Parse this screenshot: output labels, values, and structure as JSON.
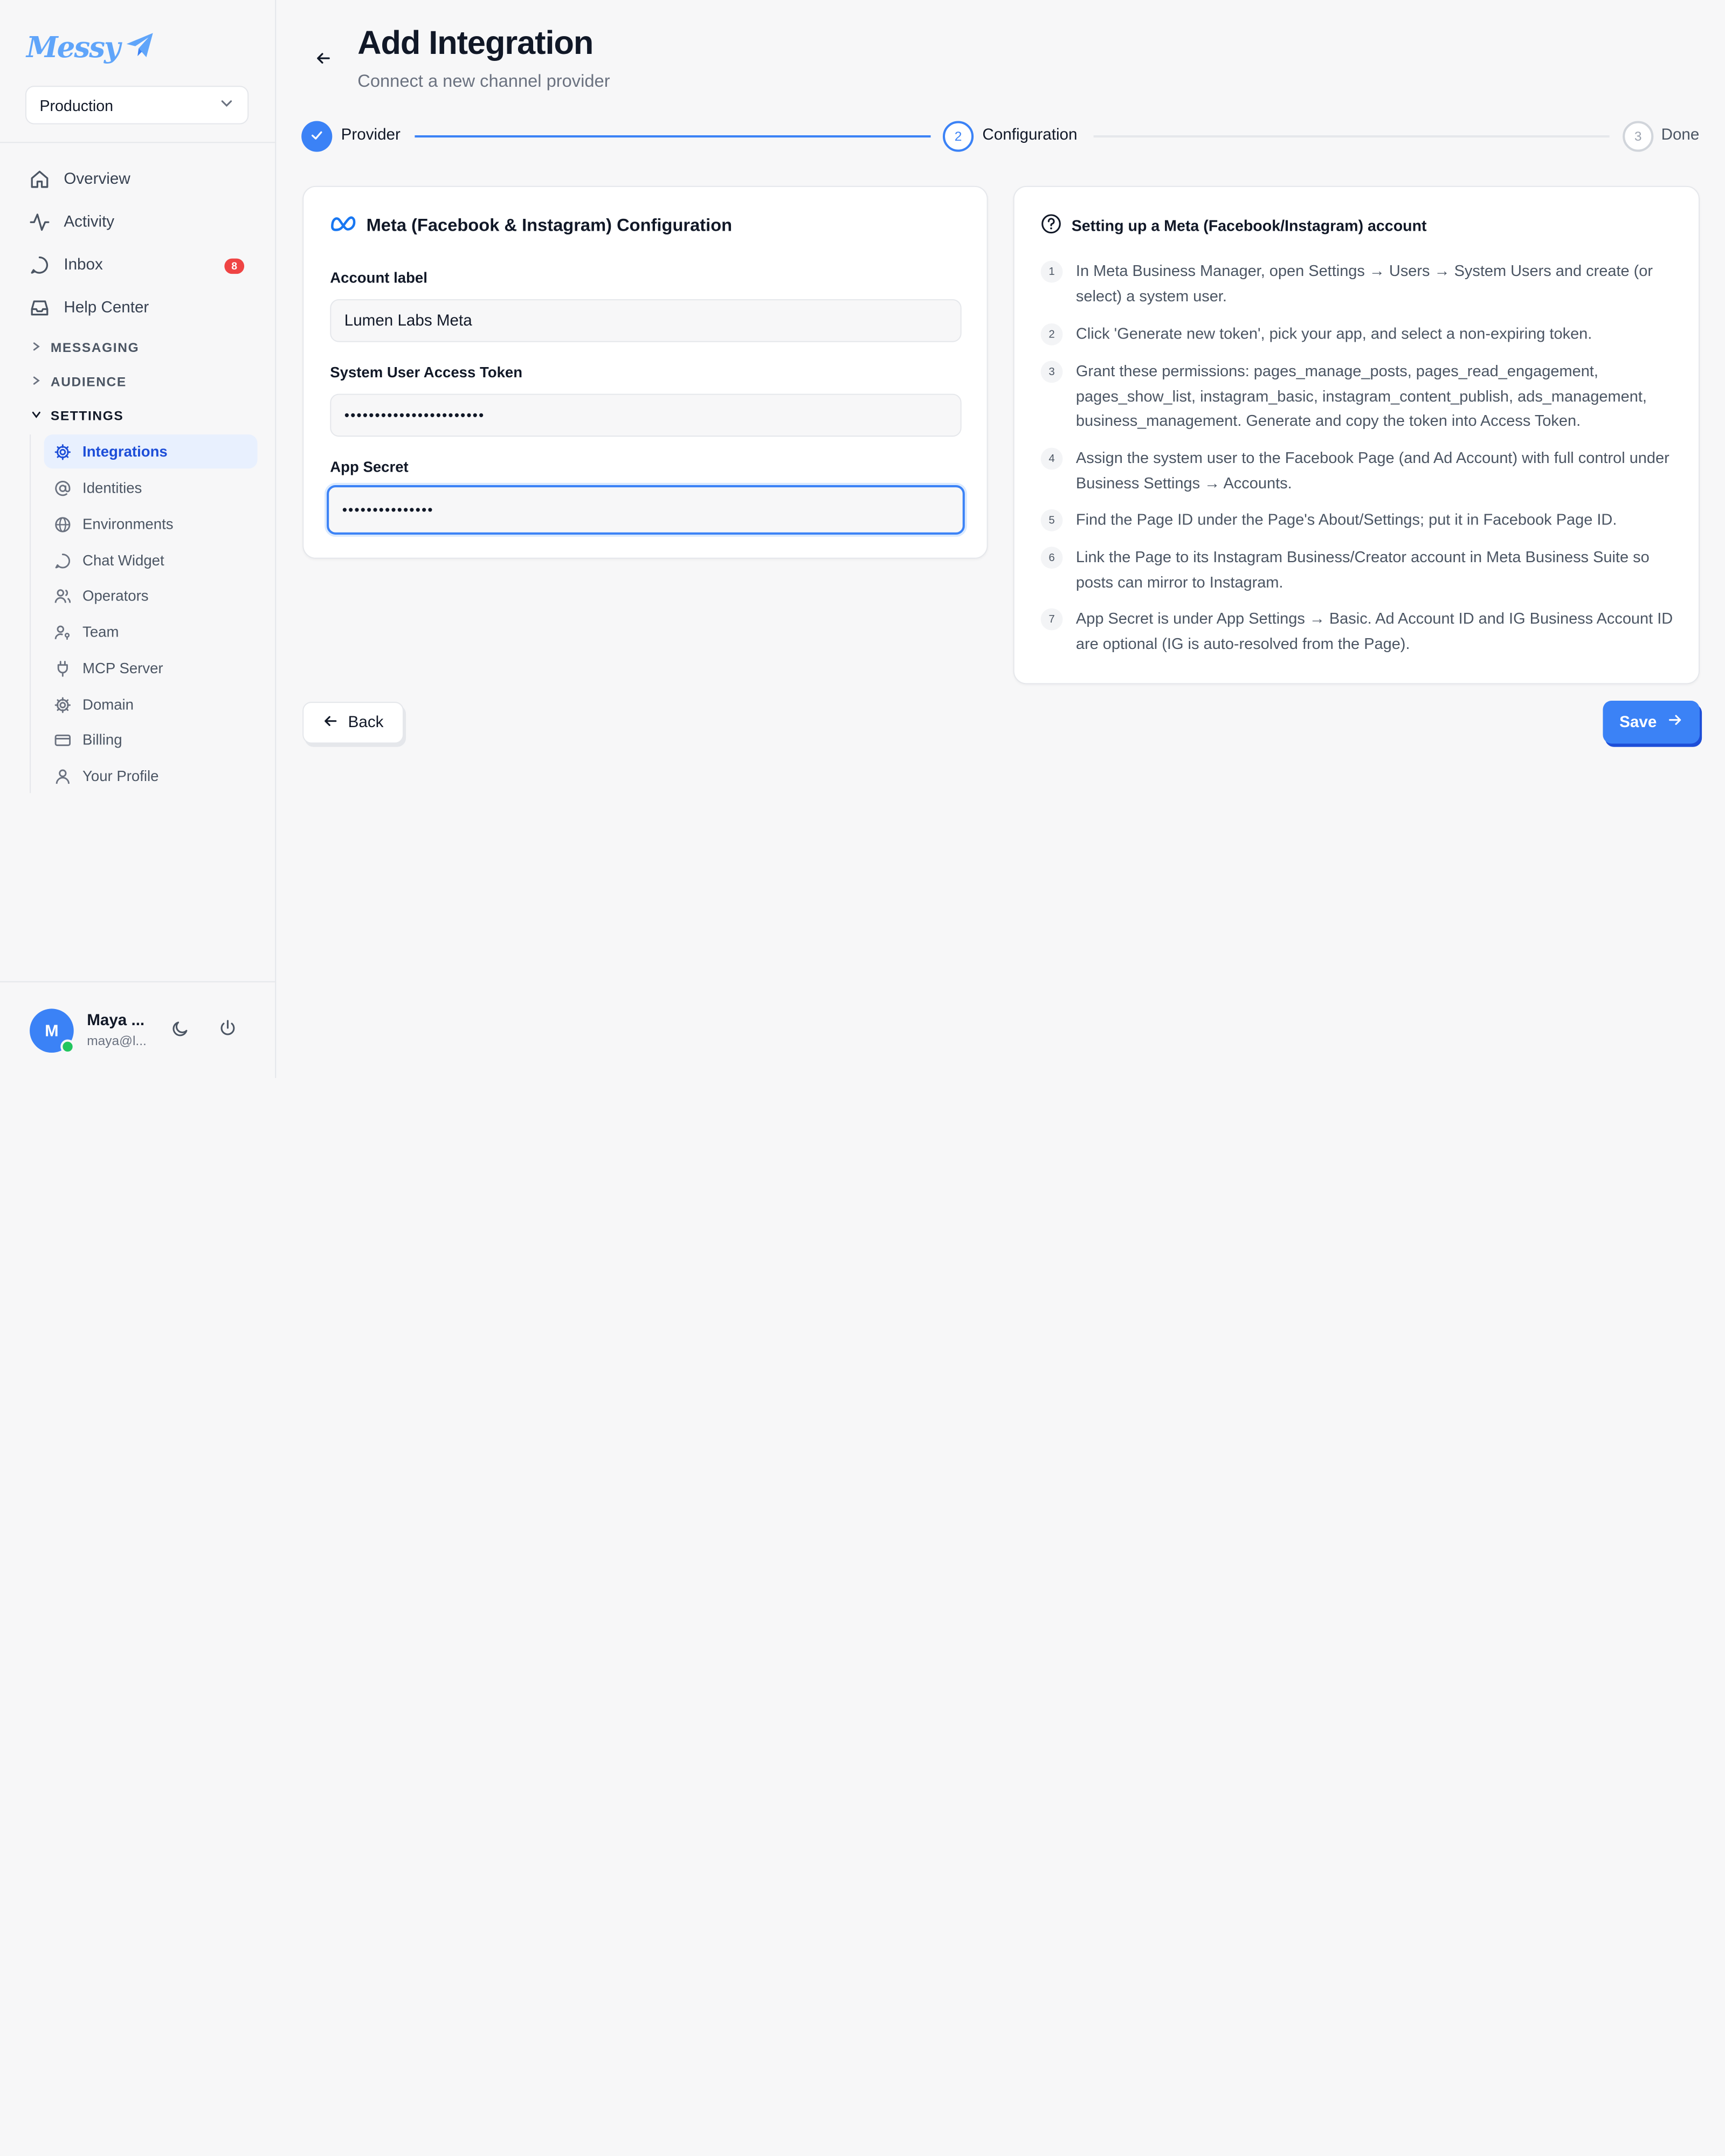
{
  "app": {
    "logo_text": "Messy"
  },
  "sidebar": {
    "environment": "Production",
    "nav": [
      {
        "label": "Overview",
        "icon": "home-icon"
      },
      {
        "label": "Activity",
        "icon": "activity-icon"
      },
      {
        "label": "Inbox",
        "icon": "chat-bubble-icon",
        "badge": "8"
      },
      {
        "label": "Help Center",
        "icon": "inbox-tray-icon"
      }
    ],
    "sections": [
      {
        "label": "MESSAGING",
        "expanded": false
      },
      {
        "label": "AUDIENCE",
        "expanded": false
      },
      {
        "label": "SETTINGS",
        "expanded": true
      }
    ],
    "settings_items": [
      {
        "label": "Integrations",
        "icon": "gear-icon",
        "active": true
      },
      {
        "label": "Identities",
        "icon": "at-sign-icon"
      },
      {
        "label": "Environments",
        "icon": "globe-icon"
      },
      {
        "label": "Chat Widget",
        "icon": "chat-bubble-icon"
      },
      {
        "label": "Operators",
        "icon": "users-icon"
      },
      {
        "label": "Team",
        "icon": "user-key-icon"
      },
      {
        "label": "MCP Server",
        "icon": "plug-icon"
      },
      {
        "label": "Domain",
        "icon": "gear-icon"
      },
      {
        "label": "Billing",
        "icon": "credit-card-icon"
      },
      {
        "label": "Your Profile",
        "icon": "user-icon"
      }
    ],
    "user": {
      "initial": "M",
      "name": "Maya ...",
      "email": "maya@l...",
      "status": "online"
    }
  },
  "header": {
    "title": "Add Integration",
    "subtitle": "Connect a new channel provider"
  },
  "stepper": {
    "steps": [
      {
        "label": "Provider",
        "state": "done",
        "number": "1"
      },
      {
        "label": "Configuration",
        "state": "active",
        "number": "2"
      },
      {
        "label": "Done",
        "state": "pending",
        "number": "3"
      }
    ]
  },
  "config": {
    "title": "Meta (Facebook & Instagram) Configuration",
    "fields": [
      {
        "label": "Account label",
        "value": "Lumen Labs Meta",
        "type": "text"
      },
      {
        "label": "System User Access Token",
        "value": "•••••••••••••••••••••••",
        "type": "password"
      },
      {
        "label": "App Secret",
        "value": "•••••••••••••••",
        "type": "password",
        "focused": true
      }
    ]
  },
  "help": {
    "title": "Setting up a Meta (Facebook/Instagram) account",
    "steps": [
      {
        "num": "1",
        "text": "In Meta Business Manager, open Settings → Users → System Users and create (or select) a system user."
      },
      {
        "num": "2",
        "text": "Click 'Generate new token', pick your app, and select a non-expiring token."
      },
      {
        "num": "3",
        "text": "Grant these permissions: pages_manage_posts, pages_read_engagement, pages_show_list, instagram_basic, instagram_content_publish, ads_management, business_management. Generate and copy the token into Access Token."
      },
      {
        "num": "4",
        "text": "Assign the system user to the Facebook Page (and Ad Account) with full control under Business Settings → Accounts."
      },
      {
        "num": "5",
        "text": "Find the Page ID under the Page's About/Settings; put it in Facebook Page ID."
      },
      {
        "num": "6",
        "text": "Link the Page to its Instagram Business/Creator account in Meta Business Suite so posts can mirror to Instagram."
      },
      {
        "num": "7",
        "text": "App Secret is under App Settings → Basic. Ad Account ID and IG Business Account ID are optional (IG is auto-resolved from the Page)."
      }
    ]
  },
  "actions": {
    "back_label": "Back",
    "save_label": "Save"
  },
  "colors": {
    "accent": "#3b82f6",
    "badge": "#ef4444",
    "online": "#22c55e"
  }
}
